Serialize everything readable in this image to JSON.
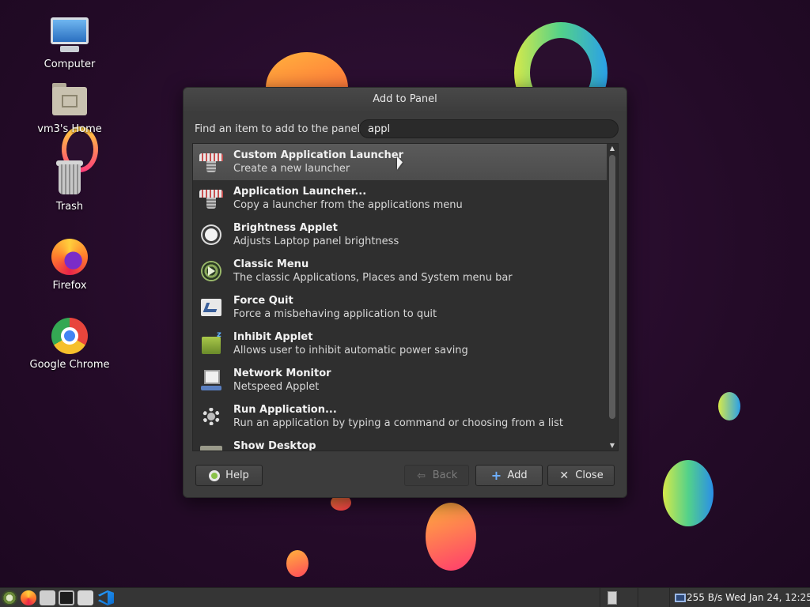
{
  "desktop": {
    "icons": [
      {
        "label": "Computer"
      },
      {
        "label": "vm3's Home"
      },
      {
        "label": "Trash"
      },
      {
        "label": "Firefox"
      },
      {
        "label": "Google Chrome"
      }
    ]
  },
  "dialog": {
    "title": "Add to Panel",
    "find_label": "Find an item to add to the panel:",
    "search_value": "appl",
    "items": [
      {
        "name": "Custom Application Launcher",
        "desc": "Create a new launcher",
        "icon": "launcher-icon",
        "selected": true
      },
      {
        "name": "Application Launcher...",
        "desc": "Copy a launcher from the applications menu",
        "icon": "launcher-icon"
      },
      {
        "name": "Brightness Applet",
        "desc": "Adjusts Laptop panel brightness",
        "icon": "brightness-icon"
      },
      {
        "name": "Classic Menu",
        "desc": "The classic Applications, Places and System menu bar",
        "icon": "classic-menu-icon"
      },
      {
        "name": "Force Quit",
        "desc": "Force a misbehaving application to quit",
        "icon": "force-quit-icon"
      },
      {
        "name": "Inhibit Applet",
        "desc": "Allows user to inhibit automatic power saving",
        "icon": "inhibit-icon"
      },
      {
        "name": "Network Monitor",
        "desc": "Netspeed Applet",
        "icon": "network-monitor-icon"
      },
      {
        "name": "Run Application...",
        "desc": "Run an application by typing a command or choosing from a list",
        "icon": "run-icon"
      },
      {
        "name": "Show Desktop",
        "desc": "",
        "icon": "show-desktop-icon"
      }
    ],
    "buttons": {
      "help": "Help",
      "back": "Back",
      "add": "Add",
      "close": "Close"
    }
  },
  "taskbar": {
    "status": "255 B/s Wed Jan 24, 12:25"
  }
}
